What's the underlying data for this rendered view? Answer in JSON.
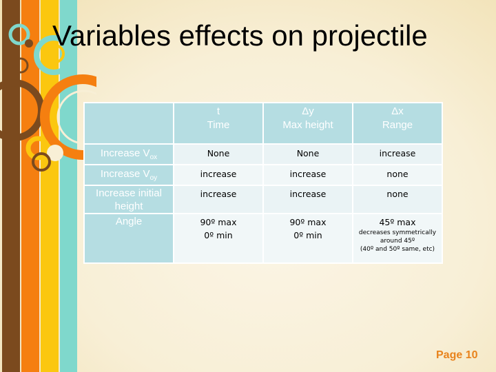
{
  "slide": {
    "title": "Variables effects on projectile",
    "page_label": "Page 10",
    "colors": {
      "header_fill": "#b5dde2",
      "cell_fill": "#eaf3f5",
      "page_label": "#e8831c",
      "stripe_brown": "#7b4a1e",
      "stripe_orange": "#f57f10",
      "stripe_yellow": "#fbc70f",
      "stripe_teal": "#7fd8cc"
    }
  },
  "table": {
    "headers": [
      {
        "line1": "",
        "line2": ""
      },
      {
        "line1": "t",
        "line2": "Time"
      },
      {
        "line1": "Δy",
        "line2": "Max height"
      },
      {
        "line1": "Δx",
        "line2": "Range"
      }
    ],
    "rows": [
      {
        "label": "Increase V",
        "label_sub": "ox",
        "time": "None",
        "height": "None",
        "range": "increase"
      },
      {
        "label": "Increase V",
        "label_sub": "oy",
        "time": "increase",
        "height": "increase",
        "range": "none"
      },
      {
        "label": "Increase initial height",
        "label_sub": "",
        "time": "increase",
        "height": "increase",
        "range": "none"
      },
      {
        "label": "Angle",
        "label_sub": "",
        "time_l1": "90º max",
        "time_l2": "0º min",
        "height_l1": "90º max",
        "height_l2": "0º min",
        "range_l1": "45º max",
        "range_note1": "decreases symmetrically",
        "range_note2": "around 45º",
        "range_note3": "(40º and 50º same, etc)"
      }
    ]
  }
}
